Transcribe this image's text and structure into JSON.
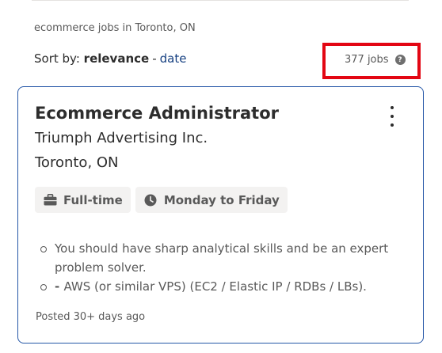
{
  "search_summary": "ecommerce jobs in Toronto, ON",
  "sort": {
    "label": "Sort by:",
    "active": "relevance",
    "separator": "-",
    "alternative": "date"
  },
  "job_count": {
    "text": "377 jobs",
    "help_icon": "help-circle-icon",
    "highlight_color": "#e30613"
  },
  "job_card": {
    "title": "Ecommerce Administrator",
    "company": "Triumph Advertising Inc.",
    "location": "Toronto, ON",
    "tags": [
      {
        "icon": "briefcase-icon",
        "label": "Full-time"
      },
      {
        "icon": "clock-icon",
        "label": "Monday to Friday"
      }
    ],
    "snippet": [
      {
        "prefix": "",
        "text": "You should have sharp analytical skills and be an expert problem solver."
      },
      {
        "prefix": "- ",
        "text": "AWS (or similar VPS) (EC2 / Elastic IP / RDBs / LBs)."
      }
    ],
    "posted": "Posted 30+ days ago",
    "border_color": "#2557a7"
  }
}
